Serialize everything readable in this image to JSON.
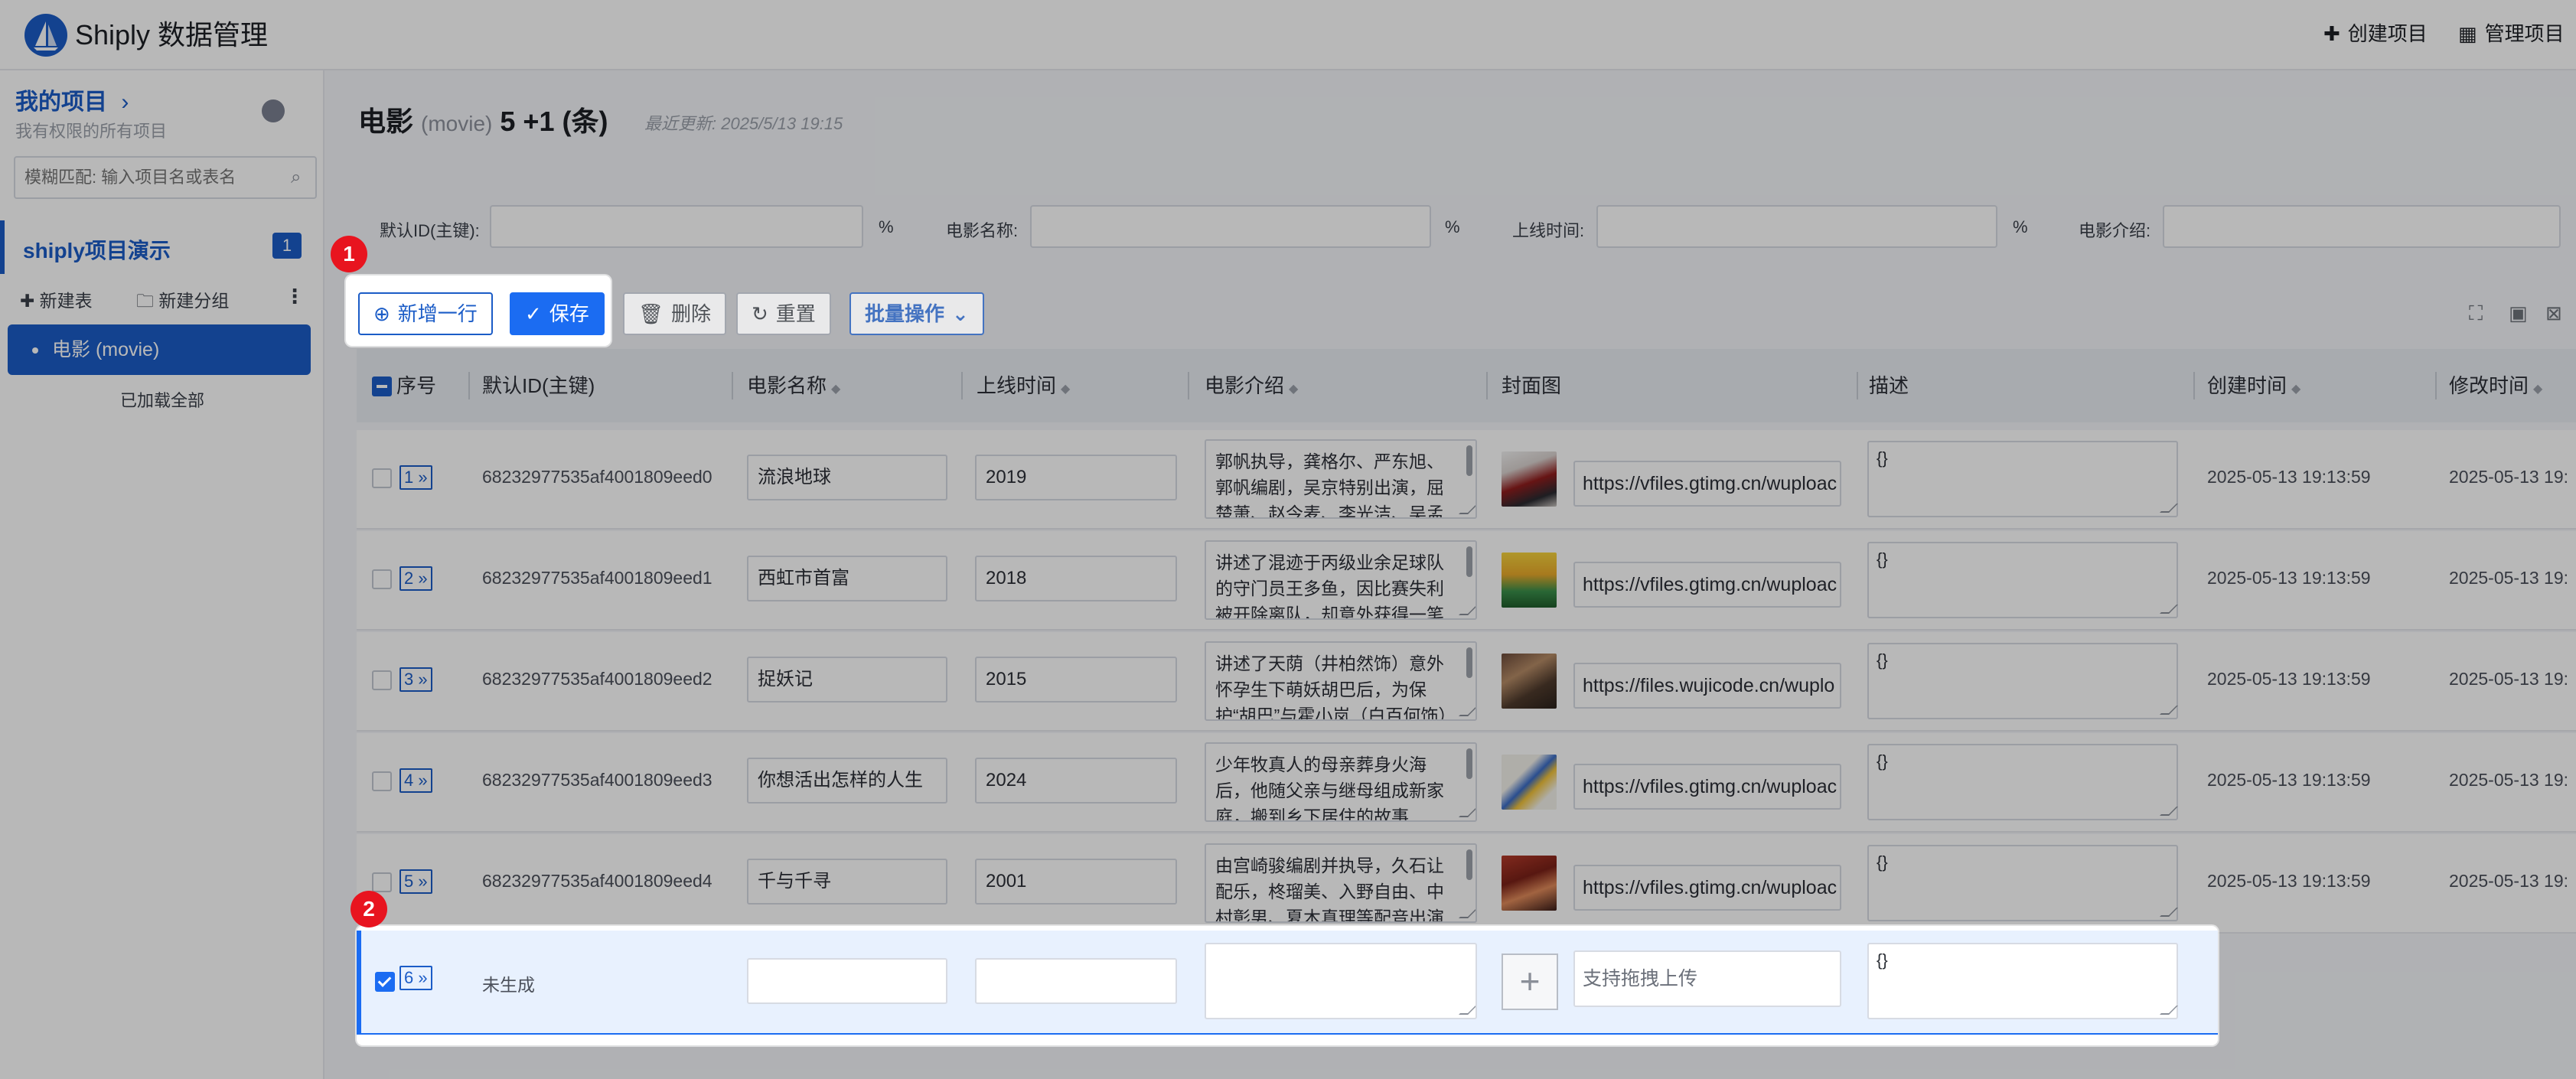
{
  "header": {
    "app_name": "Shiply 数据管理",
    "create_project": "创建项目",
    "manage_projects": "管理项目"
  },
  "sidebar": {
    "my_projects": "我的项目",
    "my_projects_sub": "我有权限的所有项目",
    "search_placeholder": "模糊匹配: 输入项目名或表名",
    "project_name": "shiply项目演示",
    "project_badge": "1",
    "new_table": "新建表",
    "new_group": "新建分组",
    "active_table": "电影 (movie)",
    "loaded_all": "已加载全部"
  },
  "main": {
    "title": "电影",
    "title_sub": "(movie)",
    "title_count": "5 +1 (条)",
    "last_updated": "最近更新: 2025/5/13 19:15",
    "filters": [
      {
        "label": "默认ID(主键):",
        "suffix": "%"
      },
      {
        "label": "电影名称:",
        "suffix": "%"
      },
      {
        "label": "上线时间:",
        "suffix": "%"
      },
      {
        "label": "电影介绍:",
        "suffix": ""
      }
    ],
    "toolbar": {
      "add_row": "新增一行",
      "save": "保存",
      "delete": "删除",
      "reset": "重置",
      "batch": "批量操作"
    }
  },
  "table": {
    "columns": [
      "序号",
      "默认ID(主键)",
      "电影名称",
      "上线时间",
      "电影介绍",
      "封面图",
      "描述",
      "创建时间",
      "修改时间"
    ],
    "rows": [
      {
        "num": "1 »",
        "id": "68232977535af4001809eed0",
        "name": "流浪地球",
        "year": "2019",
        "intro": "郭帆执导，龚格尔、严东旭、郭帆编剧，吴京特别出演，屈楚萧、赵今麦、李光洁、吴孟达",
        "cover": "https://vfiles.gtimg.cn/wuploac",
        "desc": "{}",
        "created": "2025-05-13 19:13:59",
        "modified": "2025-05-13 19:"
      },
      {
        "num": "2 »",
        "id": "68232977535af4001809eed1",
        "name": "西虹市首富",
        "year": "2018",
        "intro": "讲述了混迹于丙级业余足球队的守门员王多鱼，因比赛失利被开除离队，却意外获得一笔钱",
        "cover": "https://vfiles.gtimg.cn/wuploac",
        "desc": "{}",
        "created": "2025-05-13 19:13:59",
        "modified": "2025-05-13 19:"
      },
      {
        "num": "3 »",
        "id": "68232977535af4001809eed2",
        "name": "捉妖记",
        "year": "2015",
        "intro": "讲述了天荫（井柏然饰）意外怀孕生下萌妖胡巴后，为保护“胡巴”与霍小岚（白百何饰）",
        "cover": "https://files.wujicode.cn/wuplo",
        "desc": "{}",
        "created": "2025-05-13 19:13:59",
        "modified": "2025-05-13 19:"
      },
      {
        "num": "4 »",
        "id": "68232977535af4001809eed3",
        "name": "你想活出怎样的人生",
        "year": "2024",
        "intro": "少年牧真人的母亲葬身火海后，他随父亲与继母组成新家庭，搬到乡下居住的故事",
        "cover": "https://vfiles.gtimg.cn/wuploac",
        "desc": "{}",
        "created": "2025-05-13 19:13:59",
        "modified": "2025-05-13 19:"
      },
      {
        "num": "5 »",
        "id": "68232977535af4001809eed4",
        "name": "千与千寻",
        "year": "2001",
        "intro": "由宫崎骏编剧并执导，久石让配乐，柊瑠美、入野自由、中村彰男、夏木真理等配音出演",
        "cover": "https://vfiles.gtimg.cn/wuploac",
        "desc": "{}",
        "created": "2025-05-13 19:13:59",
        "modified": "2025-05-13 19:"
      }
    ],
    "new_row": {
      "num": "6 »",
      "id": "未生成",
      "upload_placeholder": "支持拖拽上传",
      "desc": "{}"
    }
  },
  "annotations": {
    "step1": "1",
    "step2": "2"
  },
  "colors": {
    "brand": "#1b5cc7",
    "primary_button": "#1b6cf2",
    "step_badge": "#e8141f"
  }
}
